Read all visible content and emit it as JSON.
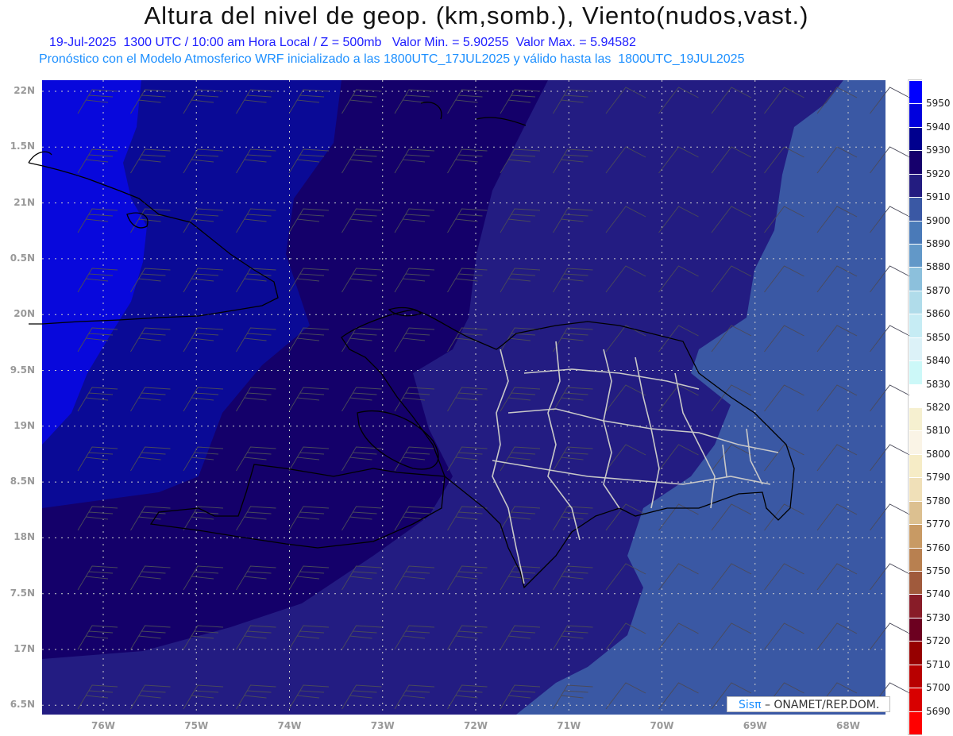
{
  "header": {
    "title": "Altura del nivel de geop. (km,somb.), Viento(nudos,vast.)",
    "subtitle": "19-Jul-2025  1300 UTC / 10:00 am Hora Local / Z = 500mb   Valor Min. = 5.90255  Valor Max. = 5.94582",
    "model_line": "Pronóstico con el Modelo Atmosferico WRF inicializado a las 1800UTC_17JUL2025 y válido hasta las  1800UTC_19JUL2025"
  },
  "axes": {
    "lat_labels": [
      "22N",
      "1.5N",
      "21N",
      "0.5N",
      "20N",
      "9.5N",
      "19N",
      "8.5N",
      "18N",
      "7.5N",
      "17N",
      "6.5N"
    ],
    "lon_labels": [
      "76W",
      "75W",
      "74W",
      "73W",
      "72W",
      "71W",
      "70W",
      "69W",
      "68W"
    ]
  },
  "colorbar": {
    "labels": [
      "5950",
      "5940",
      "5930",
      "5920",
      "5910",
      "5900",
      "5890",
      "5880",
      "5870",
      "5860",
      "5850",
      "5840",
      "5830",
      "5820",
      "5810",
      "5800",
      "5790",
      "5780",
      "5770",
      "5760",
      "5750",
      "5740",
      "5730",
      "5720",
      "5710",
      "5700",
      "5690"
    ],
    "colors": [
      "#0000ff",
      "#0000dd",
      "#00008e",
      "#16006c",
      "#231c80",
      "#3a58a4",
      "#4a7ab8",
      "#6298c8",
      "#8cc0dc",
      "#b0dcea",
      "#c6ecf4",
      "#dcf2f8",
      "#ccf8f8",
      "#ffffff",
      "#f6f0d0",
      "#faf4e6",
      "#f6ecc6",
      "#f0e0b8",
      "#dcc090",
      "#c89a64",
      "#b88050",
      "#a05a3c",
      "#881c28",
      "#6c0020",
      "#960000",
      "#b80000",
      "#d80000",
      "#ff0000"
    ]
  },
  "map_colors": {
    "c5900": "#3a58a4",
    "c5910": "#231c82",
    "c5920": "#14006a",
    "c5930": "#0a0a96",
    "c5940": "#0808dc"
  },
  "credit": {
    "brand": "Sisπ",
    "text": " – ONAMET/REP.DOM."
  }
}
